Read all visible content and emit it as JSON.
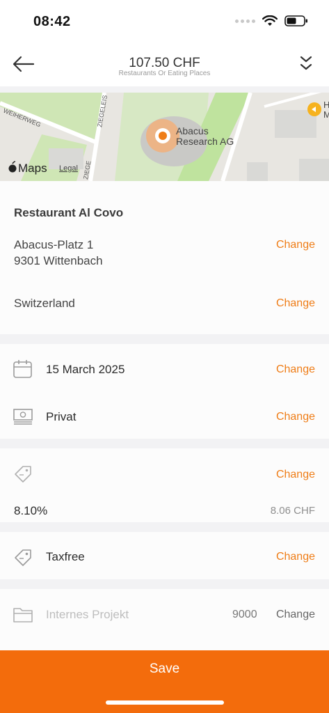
{
  "status": {
    "time": "08:42"
  },
  "header": {
    "amount": "107.50 CHF",
    "category": "Restaurants Or Eating Places"
  },
  "map": {
    "streets": [
      "WEIHERWEG",
      "ZIEGELEIS",
      "ZIEGE"
    ],
    "poi_label_line1": "Abacus",
    "poi_label_line2": "Research AG",
    "corner_label_line1": "H",
    "corner_label_line2": "M",
    "brand": "Maps",
    "legal": "Legal"
  },
  "location": {
    "name": "Restaurant Al Covo",
    "street": "Abacus-Platz 1",
    "city": "9301 Wittenbach",
    "country": "Switzerland",
    "change_address": "Change",
    "change_country": "Change"
  },
  "details": {
    "date": "15 March 2025",
    "date_change": "Change",
    "payment": "Privat",
    "payment_change": "Change"
  },
  "vat": {
    "change": "Change",
    "rate": "8.10%",
    "amount": "8.06 CHF"
  },
  "tax": {
    "label": "Taxfree",
    "change": "Change"
  },
  "project": {
    "placeholder": "Internes Projekt",
    "code": "9000",
    "change": "Change"
  },
  "footer": {
    "save_label": "Save"
  },
  "colors": {
    "accent": "#ef7d17",
    "save_bar": "#f36c0c",
    "divider": "#f2f2f4"
  }
}
